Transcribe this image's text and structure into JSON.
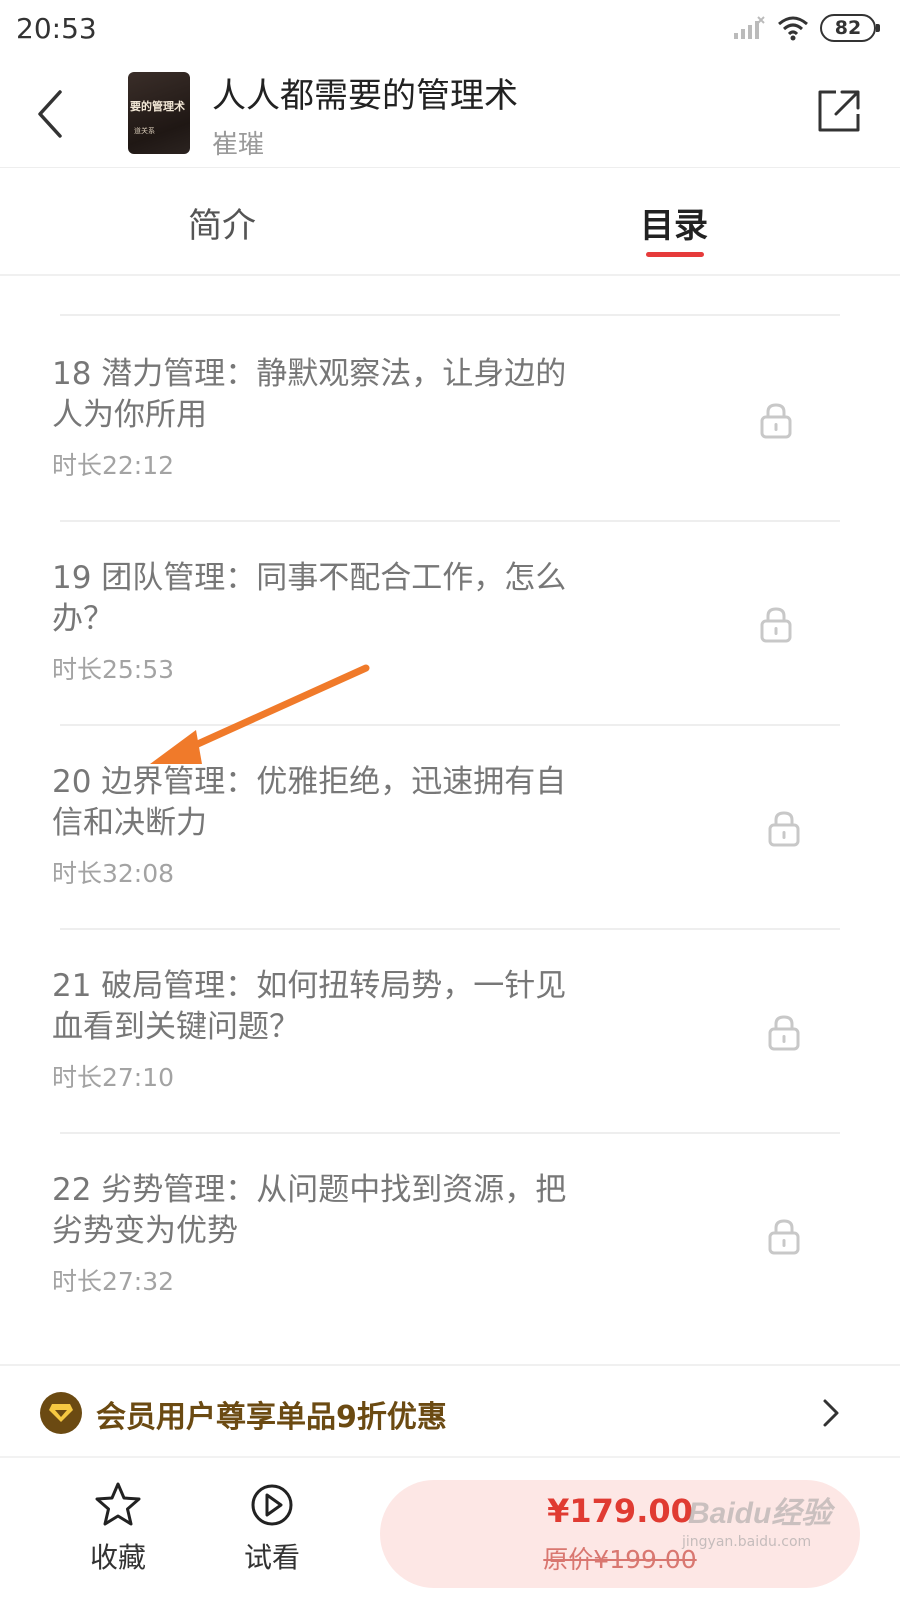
{
  "status_bar": {
    "time": "20:53",
    "battery": "82"
  },
  "header": {
    "book_title": "人人都需要的管理术",
    "author": "崔璀",
    "cover_text": "要的管理术",
    "cover_sub": "道关系"
  },
  "tabs": [
    {
      "label": "简介",
      "active": false
    },
    {
      "label": "目录",
      "active": true
    }
  ],
  "toc_items": [
    {
      "title": "18 潜力管理：静默观察法，让身边的人为你所用",
      "duration": "时长22:12",
      "locked": true
    },
    {
      "title": "19 团队管理：同事不配合工作，怎么办？",
      "duration": "时长25:53",
      "locked": true
    },
    {
      "title": "20 边界管理：优雅拒绝，迅速拥有自信和决断力",
      "duration": "时长32:08",
      "locked": true
    },
    {
      "title": "21 破局管理：如何扭转局势，一针见血看到关键问题？",
      "duration": "时长27:10",
      "locked": true
    },
    {
      "title": "22 劣势管理：从问题中找到资源，把劣势变为优势",
      "duration": "时长27:32",
      "locked": true
    }
  ],
  "member_banner": {
    "text": "会员用户尊享单品9折优惠"
  },
  "bottom_bar": {
    "favorite_label": "收藏",
    "trial_label": "试看",
    "price": "¥179.00",
    "original_price": "原价¥199.00"
  },
  "watermark": {
    "text": "Baidu经验",
    "sub": "jingyan.baidu.com"
  },
  "colors": {
    "accent": "#e63b3b",
    "price": "#e03b32",
    "member": "#6b4a12",
    "arrow": "#f07a2a"
  }
}
